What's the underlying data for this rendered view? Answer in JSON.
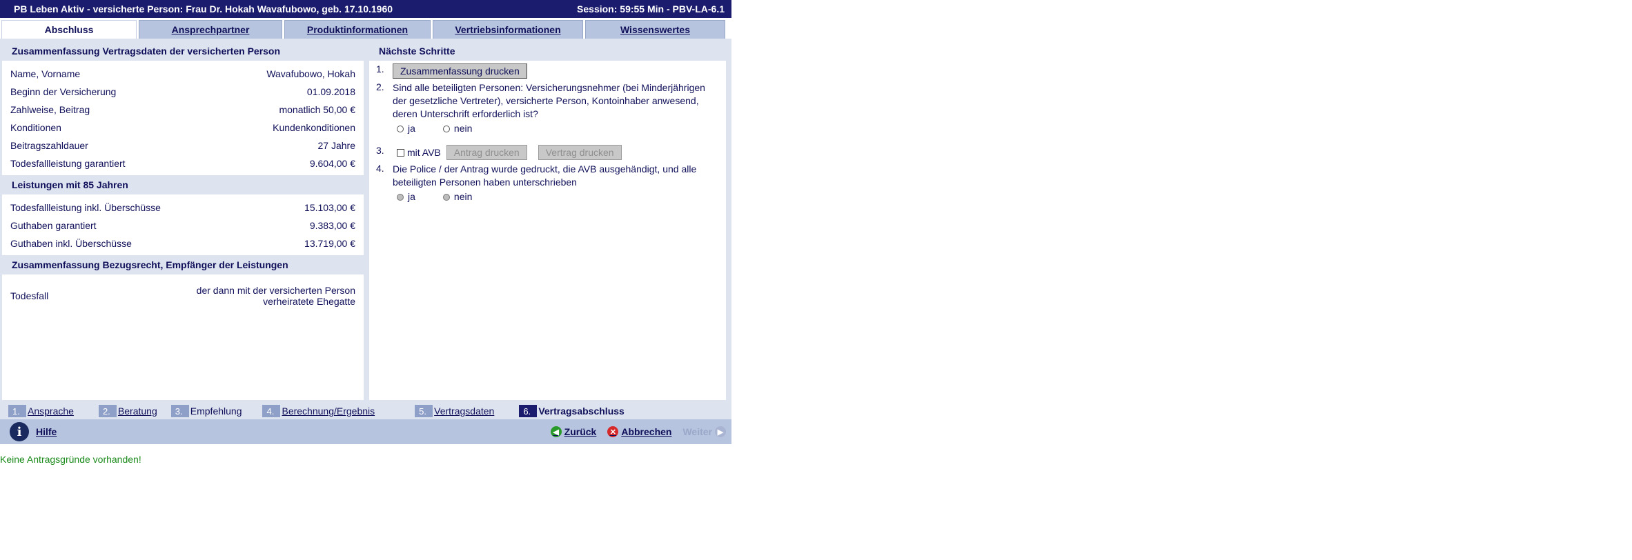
{
  "titlebar": {
    "left": "PB Leben Aktiv - versicherte Person:  Frau  Dr.  Hokah  Wavafubowo, geb.  17.10.1960",
    "right": "Session: 59:55 Min -  PBV-LA-6.1"
  },
  "tabs": [
    {
      "label": "Abschluss",
      "active": true
    },
    {
      "label": "Ansprechpartner",
      "active": false
    },
    {
      "label": "Produktinformationen",
      "active": false
    },
    {
      "label": "Vertriebsinformationen",
      "active": false
    },
    {
      "label": "Wissenswertes",
      "active": false
    }
  ],
  "left": {
    "summary_title": "Zusammenfassung Vertragsdaten der versicherten Person",
    "summary_rows": [
      {
        "label": "Name, Vorname",
        "value": "Wavafubowo,  Hokah"
      },
      {
        "label": "Beginn der Versicherung",
        "value": "01.09.2018"
      },
      {
        "label": "Zahlweise, Beitrag",
        "value": "monatlich  50,00 €"
      },
      {
        "label": "Konditionen",
        "value": "Kundenkonditionen"
      },
      {
        "label": "Beitragszahldauer",
        "value": "27 Jahre"
      },
      {
        "label": "Todesfallleistung garantiert",
        "value": "9.604,00 €"
      }
    ],
    "benefits_title": "Leistungen mit 85 Jahren",
    "benefits_rows": [
      {
        "label": "Todesfallleistung inkl. Überschüsse",
        "value": "15.103,00 €"
      },
      {
        "label": "Guthaben garantiert",
        "value": "9.383,00 €"
      },
      {
        "label": "Guthaben inkl. Überschüsse",
        "value": "13.719,00 €"
      }
    ],
    "beneficiary_title": "Zusammenfassung Bezugsrecht, Empfänger der Leistungen",
    "beneficiary_rows": [
      {
        "label": "Todesfall",
        "value_line1": "der dann mit der versicherten Person",
        "value_line2": "verheiratete Ehegatte"
      }
    ]
  },
  "right": {
    "title": "Nächste Schritte",
    "step1": {
      "num": "1.",
      "button": "Zusammenfassung drucken"
    },
    "step2": {
      "num": "2.",
      "text": "Sind alle beteiligten Personen: Versicherungsnehmer (bei Minderjährigen der gesetzliche Vertreter), versicherte Person, Kontoinhaber anwesend, deren Unterschrift erforderlich ist?",
      "yes": "ja",
      "no": "nein"
    },
    "step3": {
      "num": "3.",
      "checkbox_label": "mit AVB",
      "btn_antrag": "Antrag drucken",
      "btn_vertrag": "Vertrag drucken"
    },
    "step4": {
      "num": "4.",
      "text": "Die Police / der Antrag wurde gedruckt, die AVB ausgehändigt, und alle beteiligten Personen haben unterschrieben",
      "yes": "ja",
      "no": "nein"
    }
  },
  "progress": [
    {
      "num": "1.",
      "label": "Ansprache",
      "state": "link"
    },
    {
      "num": "2.",
      "label": "Beratung",
      "state": "link"
    },
    {
      "num": "3.",
      "label": "Empfehlung",
      "state": "plain"
    },
    {
      "num": "4.",
      "label": "Berechnung/Ergebnis",
      "state": "link"
    },
    {
      "num": "5.",
      "label": "Vertragsdaten",
      "state": "link"
    },
    {
      "num": "6.",
      "label": "Vertragsabschluss",
      "state": "current"
    }
  ],
  "footer": {
    "help": "Hilfe",
    "back": "Zurück",
    "cancel": "Abbrechen",
    "next": "Weiter"
  },
  "status_message": "Keine Antragsgründe vorhanden!",
  "colors": {
    "titlebar": "#1c1c6e",
    "tab_inactive": "#b7c4df",
    "section_bg": "#dde3ef",
    "status_green": "#1a8a1a"
  }
}
